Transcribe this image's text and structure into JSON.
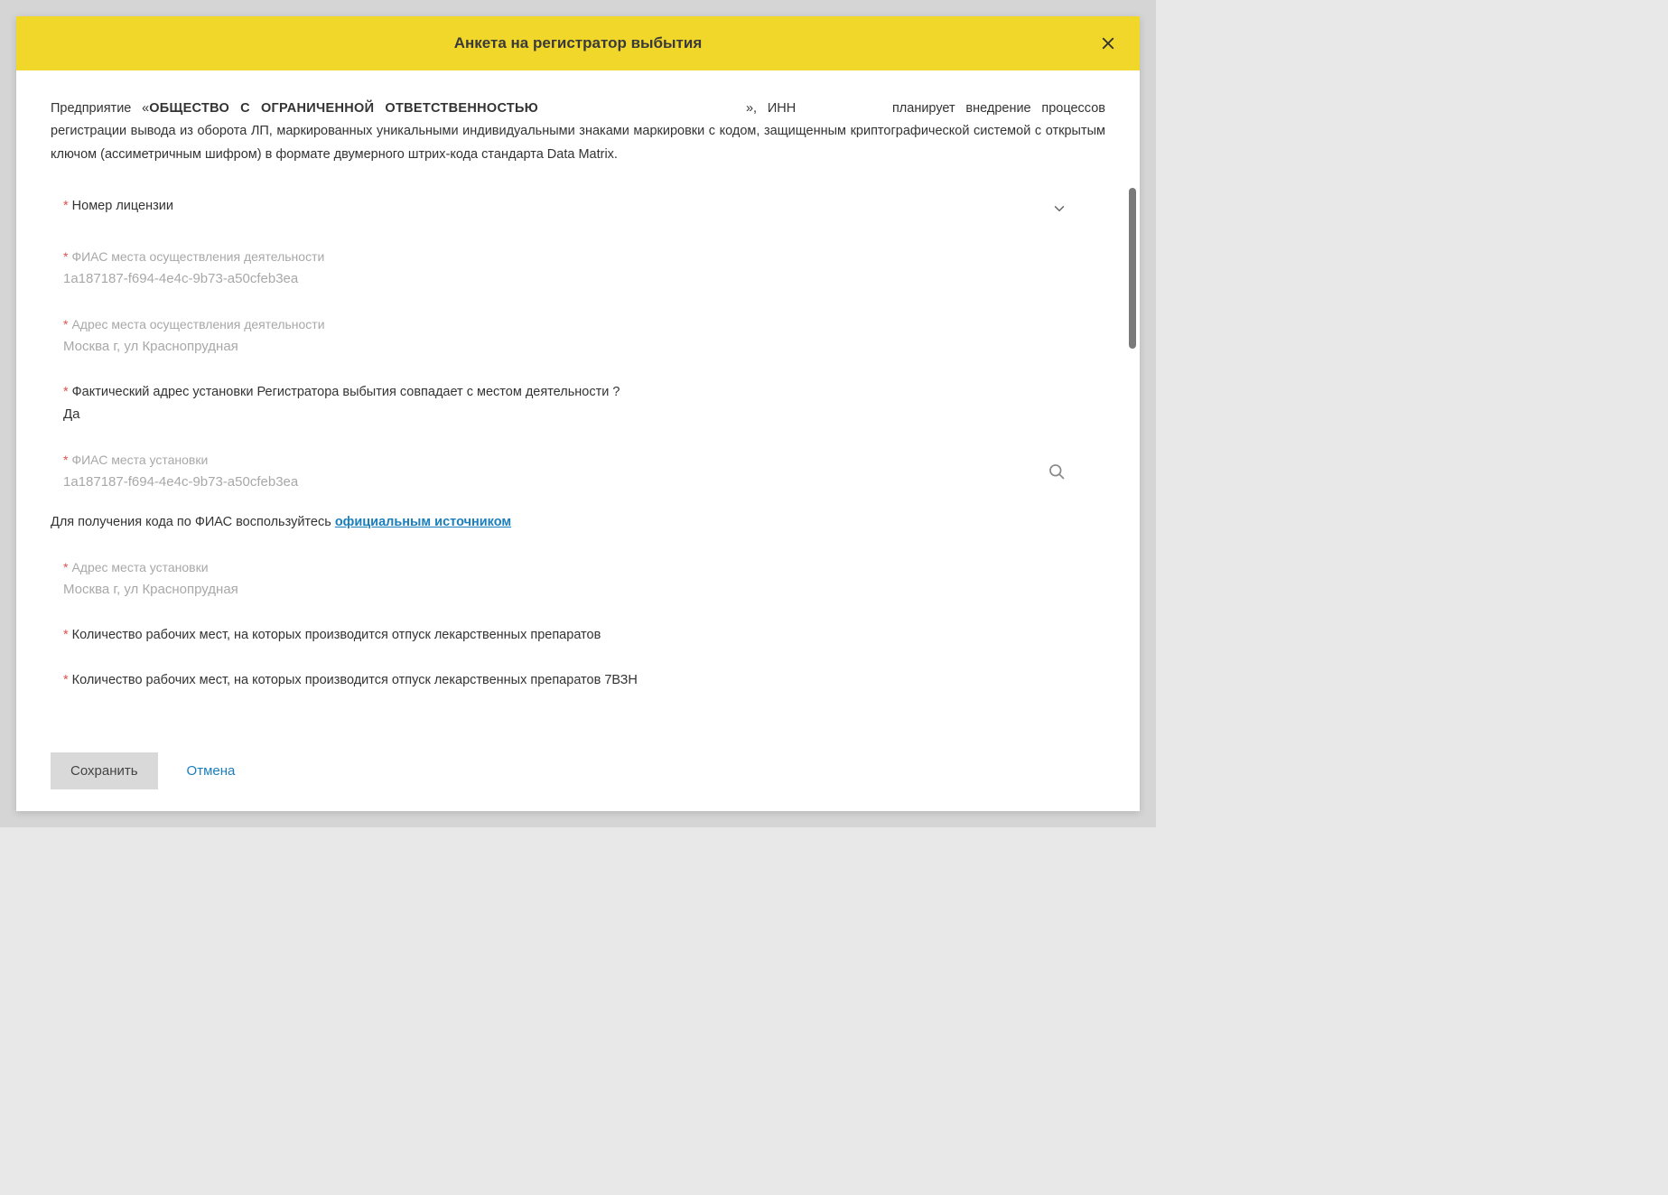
{
  "modal": {
    "title": "Анкета на регистратор выбытия"
  },
  "intro": {
    "prefix": "Предприятие «",
    "company": "ОБЩЕСТВО С ОГРАНИЧЕННОЙ ОТВЕТСТВЕННОСТЬЮ",
    "mid": "», ИНН",
    "inn": "",
    "suffix": " планирует внедрение процессов регистрации вывода из оборота ЛП, маркированных уникальными индивидуальными знаками маркировки с кодом, защищенным криптографической системой с открытым ключом (ассиметричным шифром) в формате двумерного штрих-кода стандарта Data Matrix."
  },
  "fields": {
    "license": {
      "label": "Номер лицензии"
    },
    "fias_activity": {
      "label": "ФИАС места осуществления деятельности",
      "value": "1a187187-f694-4e4c-9b73-a50cfeb3ea"
    },
    "address_activity": {
      "label": "Адрес места осуществления деятельности",
      "value": "Москва г, ул Краснопрудная"
    },
    "same_address": {
      "label": "Фактический адрес установки Регистратора выбытия совпадает с местом деятельности ?",
      "value": "Да"
    },
    "fias_install": {
      "label": "ФИАС места установки",
      "value": "1a187187-f694-4e4c-9b73-a50cfeb3ea"
    },
    "fias_hint": {
      "text": "Для получения кода по ФИАС воспользуйтесь ",
      "link": "официальным источником"
    },
    "address_install": {
      "label": "Адрес места установки",
      "value": "Москва г, ул Краснопрудная"
    },
    "workplaces": {
      "label": "Количество рабочих мест, на которых производится отпуск лекарственных препаратов"
    },
    "workplaces_7vzn": {
      "label": "Количество рабочих мест, на которых производится отпуск лекарственных препаратов 7ВЗН"
    }
  },
  "footer": {
    "save": "Сохранить",
    "cancel": "Отмена"
  }
}
